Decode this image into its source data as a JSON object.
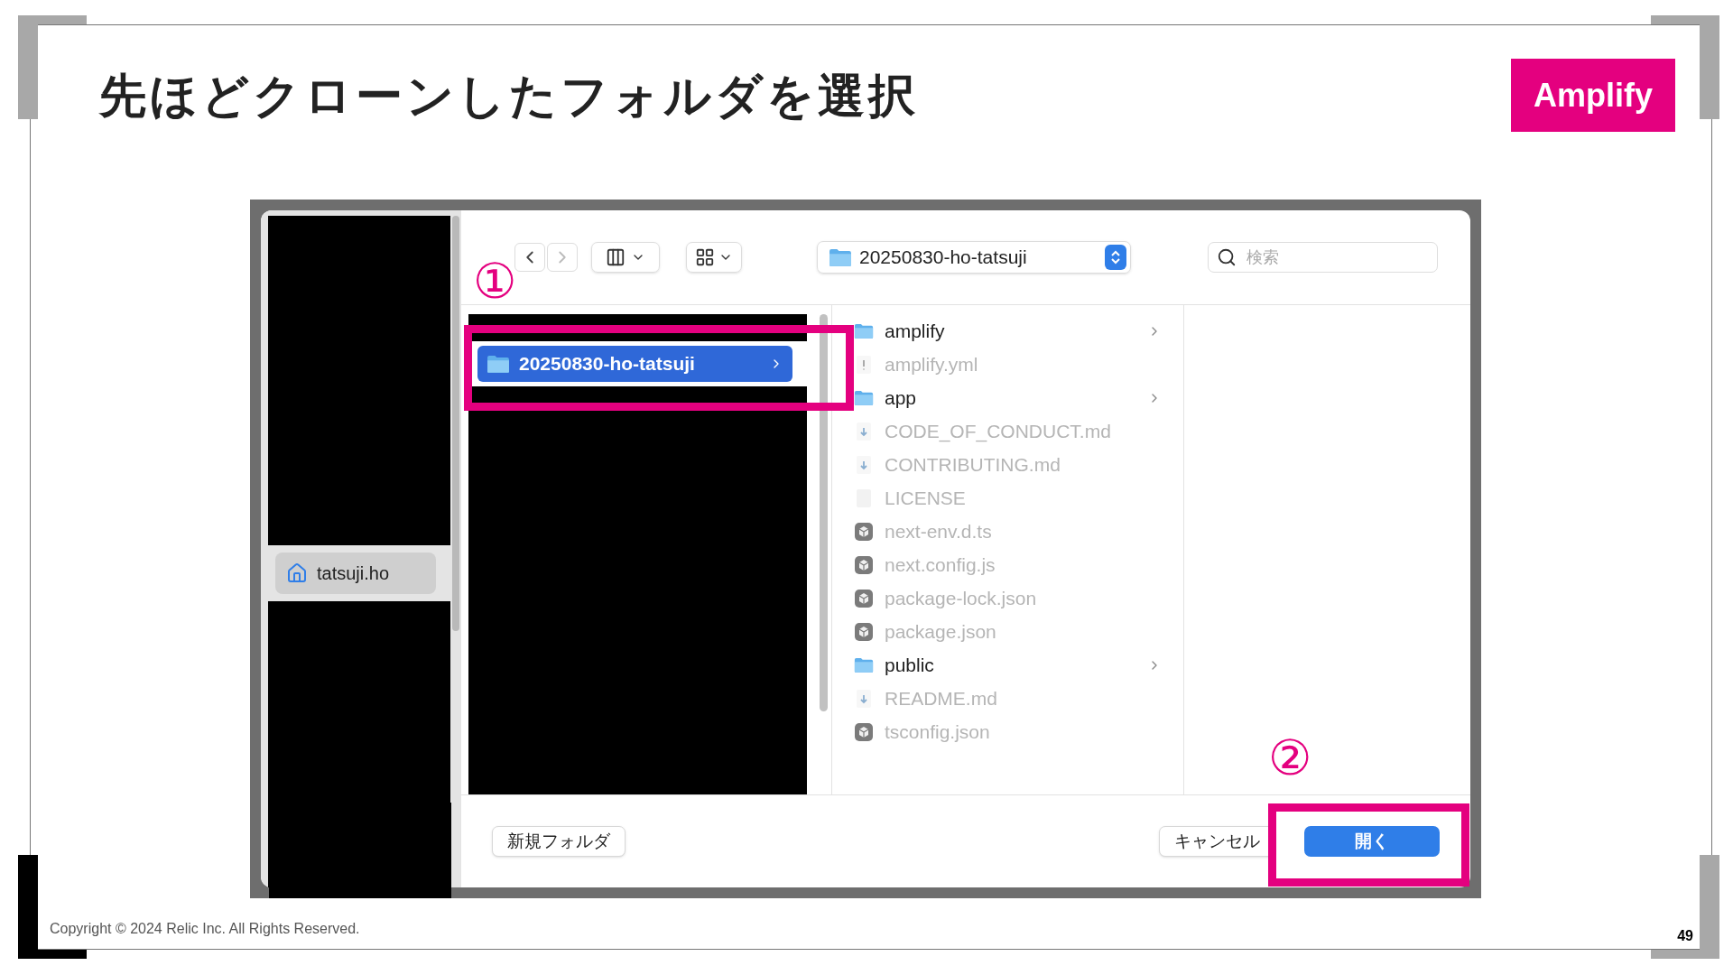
{
  "slide": {
    "title": "先ほどクローンしたフォルダを選択",
    "badge": "Amplify",
    "footer": "Copyright © 2024 Relic Inc. All Rights Reserved.",
    "page_number": "49"
  },
  "annotations": [
    {
      "label": "①"
    },
    {
      "label": "②"
    }
  ],
  "dialog": {
    "toolbar": {
      "path": "20250830-ho-tatsuji",
      "search": {
        "placeholder": "検索"
      }
    },
    "sidebar": {
      "items": [
        {
          "label": "tatsuji.ho",
          "selected": true
        }
      ]
    },
    "column_1": {
      "items": [
        {
          "label": "20250830-ho-tatsuji",
          "selected": true
        }
      ]
    },
    "column_2": {
      "items": [
        {
          "name": "amplify",
          "kind": "folder",
          "disabled": false
        },
        {
          "name": "amplify.yml",
          "kind": "yaml",
          "disabled": true
        },
        {
          "name": "app",
          "kind": "folder",
          "disabled": false
        },
        {
          "name": "CODE_OF_CONDUCT.md",
          "kind": "markdown",
          "disabled": true
        },
        {
          "name": "CONTRIBUTING.md",
          "kind": "markdown",
          "disabled": true
        },
        {
          "name": "LICENSE",
          "kind": "blank",
          "disabled": true
        },
        {
          "name": "next-env.d.ts",
          "kind": "code",
          "disabled": true
        },
        {
          "name": "next.config.js",
          "kind": "code",
          "disabled": true
        },
        {
          "name": "package-lock.json",
          "kind": "code",
          "disabled": true
        },
        {
          "name": "package.json",
          "kind": "code",
          "disabled": true
        },
        {
          "name": "public",
          "kind": "folder",
          "disabled": false
        },
        {
          "name": "README.md",
          "kind": "markdown",
          "disabled": true
        },
        {
          "name": "tsconfig.json",
          "kind": "code",
          "disabled": true
        }
      ]
    },
    "buttons": [
      {
        "label": "新規フォルダ",
        "kind": "plain"
      },
      {
        "label": "キャンセル",
        "kind": "plain"
      },
      {
        "label": "開く",
        "kind": "primary"
      }
    ]
  }
}
